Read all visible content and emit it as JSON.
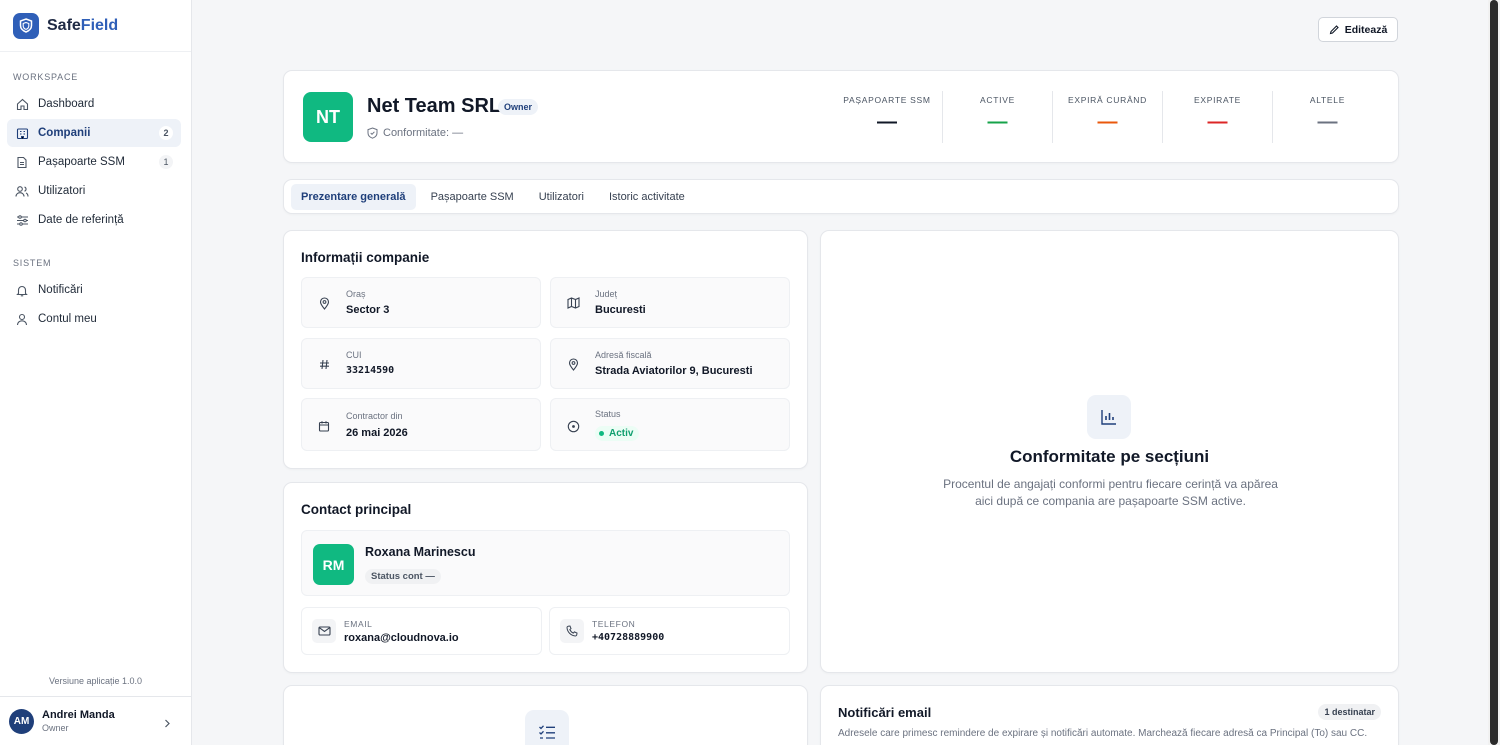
{
  "brand": {
    "name_part1": "Safe",
    "name_part2": "Field"
  },
  "sidebar": {
    "workspace_label": "WORKSPACE",
    "items": [
      {
        "label": "Dashboard",
        "icon": "home-icon"
      },
      {
        "label": "Companii",
        "icon": "building-icon",
        "badge": "2",
        "active": true
      },
      {
        "label": "Pașapoarte SSM",
        "icon": "document-icon",
        "badge": "1"
      },
      {
        "label": "Utilizatori",
        "icon": "users-icon"
      },
      {
        "label": "Date de referință",
        "icon": "sliders-icon"
      }
    ],
    "system_label": "SISTEM",
    "system_items": [
      {
        "label": "Notificări",
        "icon": "bell-icon"
      },
      {
        "label": "Contul meu",
        "icon": "user-icon"
      }
    ],
    "version": "Versiune aplicație 1.0.0",
    "user": {
      "initials": "AM",
      "name": "Andrei Manda",
      "role": "Owner"
    }
  },
  "toolbar": {
    "edit_label": "Editează"
  },
  "company": {
    "initials": "NT",
    "name": "Net Team SRL",
    "role_badge": "Owner",
    "conformity": "Conformitate: —",
    "stats": [
      {
        "label": "PAȘAPOARTE SSM",
        "value": "—",
        "color": "#111827"
      },
      {
        "label": "ACTIVE",
        "value": "—",
        "color": "#16a34a"
      },
      {
        "label": "EXPIRĂ CURÂND",
        "value": "—",
        "color": "#ea580c"
      },
      {
        "label": "EXPIRATE",
        "value": "—",
        "color": "#dc2626"
      },
      {
        "label": "ALTELE",
        "value": "—",
        "color": "#6b7280"
      }
    ]
  },
  "tabs": [
    "Prezentare generală",
    "Pașapoarte SSM",
    "Utilizatori",
    "Istoric activitate"
  ],
  "info": {
    "title": "Informații companie",
    "fields": {
      "oras": {
        "label": "Oraș",
        "value": "Sector 3"
      },
      "judet": {
        "label": "Județ",
        "value": "Bucuresti"
      },
      "cui": {
        "label": "CUI",
        "value": "33214590"
      },
      "adresa": {
        "label": "Adresă fiscală",
        "value": "Strada Aviatorilor 9, Bucuresti"
      },
      "contractor": {
        "label": "Contractor din",
        "value": "26 mai 2026"
      },
      "status": {
        "label": "Status",
        "value": "Activ"
      }
    }
  },
  "contact": {
    "title": "Contact principal",
    "initials": "RM",
    "name": "Roxana Marinescu",
    "account_status": "Status cont —",
    "email_label": "EMAIL",
    "email": "roxana@cloudnova.io",
    "phone_label": "TELEFON",
    "phone": "+40728889900"
  },
  "conformity_sections": {
    "title": "Conformitate pe secțiuni",
    "description": "Procentul de angajați conformi pentru fiecare cerință va apărea aici după ce compania are pașapoarte SSM active."
  },
  "email_notifications": {
    "title": "Notificări email",
    "badge": "1 destinatar",
    "description": "Adresele care primesc remindere de expirare și notificări automate. Marchează fiecare adresă ca Principal (To) sau CC."
  }
}
